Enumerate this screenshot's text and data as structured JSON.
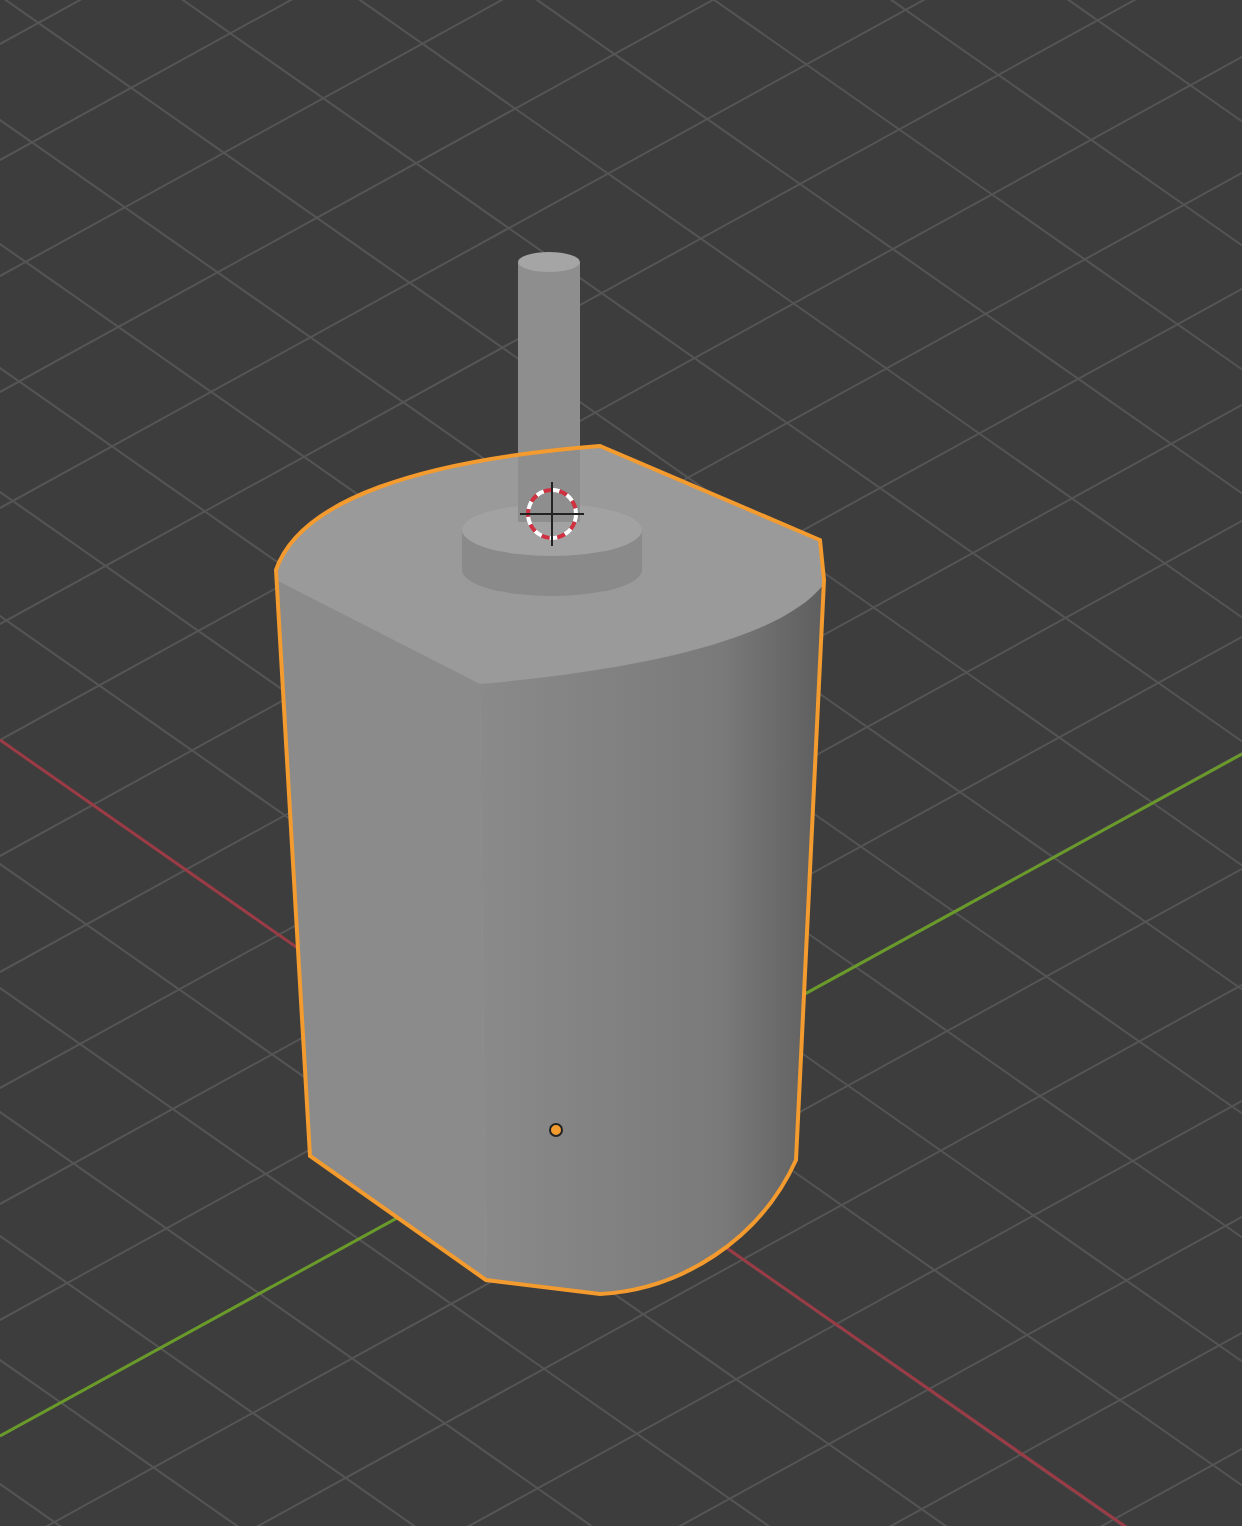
{
  "object": {
    "selected": true
  }
}
